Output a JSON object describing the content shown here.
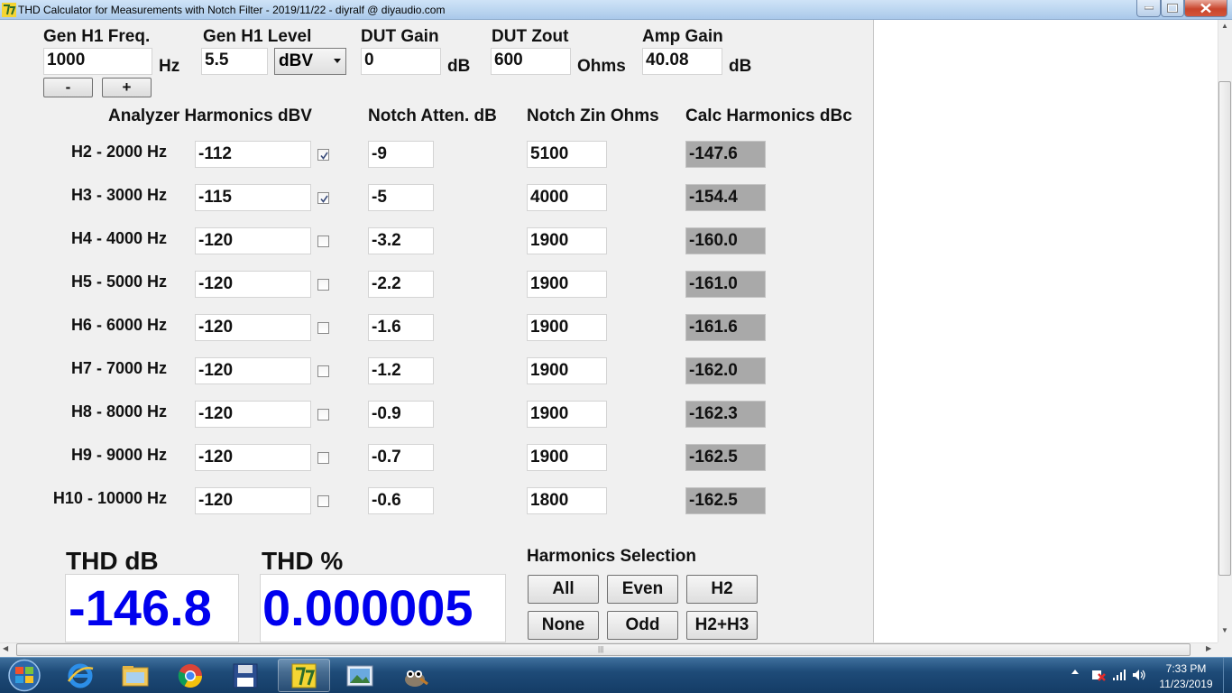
{
  "window": {
    "title": "THD Calculator for Measurements with Notch Filter - 2019/11/22 - diyralf @ diyaudio.com"
  },
  "top": {
    "gen_freq_label": "Gen H1 Freq.",
    "gen_freq_value": "1000",
    "gen_freq_unit": "Hz",
    "minus_label": "-",
    "plus_label": "+",
    "gen_level_label": "Gen H1 Level",
    "gen_level_value": "5.5",
    "level_unit_selected": "dBV",
    "dut_gain_label": "DUT Gain",
    "dut_gain_value": "0",
    "dut_gain_unit": "dB",
    "dut_zout_label": "DUT Zout",
    "dut_zout_value": "600",
    "dut_zout_unit": "Ohms",
    "amp_gain_label": "Amp Gain",
    "amp_gain_value": "40.08",
    "amp_gain_unit": "dB"
  },
  "headers": {
    "analyzer": "Analyzer Harmonics dBV",
    "notch_atten": "Notch Atten. dB",
    "notch_zin": "Notch Zin Ohms",
    "calc": "Calc Harmonics dBc"
  },
  "harmonics": [
    {
      "label": "H2 - 2000 Hz",
      "analyzer": "-112",
      "checked": true,
      "atten": "-9",
      "zin": "5100",
      "calc": "-147.6"
    },
    {
      "label": "H3 - 3000 Hz",
      "analyzer": "-115",
      "checked": true,
      "atten": "-5",
      "zin": "4000",
      "calc": "-154.4"
    },
    {
      "label": "H4 - 4000 Hz",
      "analyzer": "-120",
      "checked": false,
      "atten": "-3.2",
      "zin": "1900",
      "calc": "-160.0"
    },
    {
      "label": "H5 - 5000 Hz",
      "analyzer": "-120",
      "checked": false,
      "atten": "-2.2",
      "zin": "1900",
      "calc": "-161.0"
    },
    {
      "label": "H6 - 6000 Hz",
      "analyzer": "-120",
      "checked": false,
      "atten": "-1.6",
      "zin": "1900",
      "calc": "-161.6"
    },
    {
      "label": "H7 - 7000 Hz",
      "analyzer": "-120",
      "checked": false,
      "atten": "-1.2",
      "zin": "1900",
      "calc": "-162.0"
    },
    {
      "label": "H8 - 8000 Hz",
      "analyzer": "-120",
      "checked": false,
      "atten": "-0.9",
      "zin": "1900",
      "calc": "-162.3"
    },
    {
      "label": "H9 - 9000 Hz",
      "analyzer": "-120",
      "checked": false,
      "atten": "-0.7",
      "zin": "1900",
      "calc": "-162.5"
    },
    {
      "label": "H10 - 10000 Hz",
      "analyzer": "-120",
      "checked": false,
      "atten": "-0.6",
      "zin": "1800",
      "calc": "-162.5"
    }
  ],
  "results": {
    "thd_db_label": "THD dB",
    "thd_db_value": "-146.8",
    "thd_pct_label": "THD %",
    "thd_pct_value": "0.000005"
  },
  "selection": {
    "title": "Harmonics Selection",
    "all": "All",
    "even": "Even",
    "h2": "H2",
    "none": "None",
    "odd": "Odd",
    "h2h3": "H2+H3"
  },
  "taskbar": {
    "time": "7:33 PM",
    "date": "11/23/2019"
  },
  "colors": {
    "result_value": "#0000ee",
    "calc_field": "#a9a9a9"
  }
}
